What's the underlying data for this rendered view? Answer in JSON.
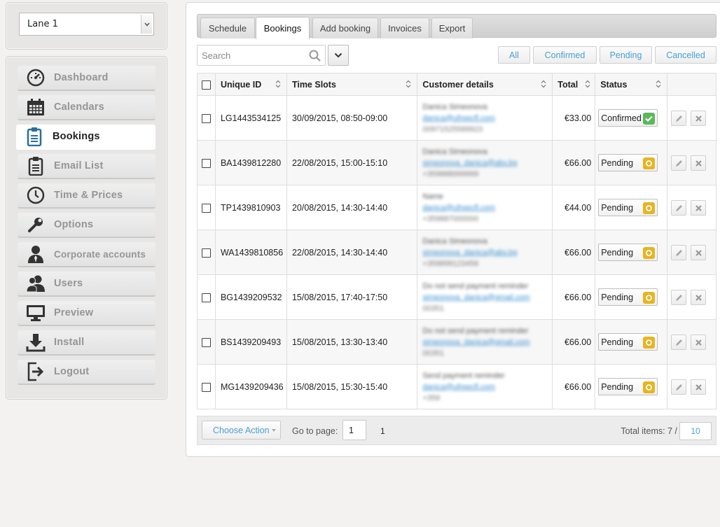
{
  "lane_select": {
    "value": "Lane 1"
  },
  "sidebar": {
    "items": [
      {
        "label": "Dashboard",
        "icon": "dashboard-icon"
      },
      {
        "label": "Calendars",
        "icon": "calendar-icon"
      },
      {
        "label": "Bookings",
        "icon": "clipboard-icon",
        "active": true
      },
      {
        "label": "Email List",
        "icon": "clipboard-icon"
      },
      {
        "label": "Time & Prices",
        "icon": "clock-icon"
      },
      {
        "label": "Options",
        "icon": "wrench-icon"
      },
      {
        "label": "Corporate accounts",
        "icon": "businessman-icon"
      },
      {
        "label": "Users",
        "icon": "users-icon"
      },
      {
        "label": "Preview",
        "icon": "monitor-icon"
      },
      {
        "label": "Install",
        "icon": "download-icon"
      },
      {
        "label": "Logout",
        "icon": "logout-icon"
      }
    ]
  },
  "tabs": [
    {
      "label": "Schedule"
    },
    {
      "label": "Bookings",
      "active": true
    },
    {
      "label": "Add booking"
    },
    {
      "label": "Invoices"
    },
    {
      "label": "Export"
    }
  ],
  "search": {
    "placeholder": "Search"
  },
  "filters": [
    {
      "label": "All"
    },
    {
      "label": "Confirmed"
    },
    {
      "label": "Pending"
    },
    {
      "label": "Cancelled"
    }
  ],
  "table": {
    "columns": [
      "Unique ID",
      "Time Slots",
      "Customer details",
      "Total",
      "Status"
    ],
    "rows": [
      {
        "id": "LG1443534125",
        "slot": "30/09/2015, 08:50-09:00",
        "cust": [
          "Danica Simeonova",
          "danica@ufreecfl.com",
          "00971525589923"
        ],
        "total": "€33.00",
        "status": "Confirmed"
      },
      {
        "id": "BA1439812280",
        "slot": "22/08/2015, 15:00-15:10",
        "cust": [
          "Danica Simeonova",
          "simeonova_danica@abv.bg",
          "+359888999999"
        ],
        "total": "€66.00",
        "status": "Pending"
      },
      {
        "id": "TP1439810903",
        "slot": "20/08/2015, 14:30-14:40",
        "cust": [
          "Name",
          "danica@ufreecfl.com",
          "+359887000000"
        ],
        "total": "€44.00",
        "status": "Pending"
      },
      {
        "id": "WA1439810856",
        "slot": "22/08/2015, 14:30-14:40",
        "cust": [
          "Danica Simeonova",
          "simeonova_danica@abv.bg",
          "+359899123456"
        ],
        "total": "€66.00",
        "status": "Pending"
      },
      {
        "id": "BG1439209532",
        "slot": "15/08/2015, 17:40-17:50",
        "cust": [
          "Do not send payment reminder",
          "simeonova_danica@gmail.com",
          "00351"
        ],
        "total": "€66.00",
        "status": "Pending"
      },
      {
        "id": "BS1439209493",
        "slot": "15/08/2015, 13:30-13:40",
        "cust": [
          "Do not send payment reminder",
          "simeonova_danica@gmail.com",
          "00351"
        ],
        "total": "€66.00",
        "status": "Pending"
      },
      {
        "id": "MG1439209436",
        "slot": "15/08/2015, 15:30-15:40",
        "cust": [
          "Send payment reminder",
          "danica@ufreecfl.com",
          "+359"
        ],
        "total": "€66.00",
        "status": "Pending"
      }
    ]
  },
  "footer": {
    "choose_action": "Choose Action",
    "goto_label": "Go to page:",
    "goto_value": "1",
    "pages": "1",
    "total_label": "Total items: 7 /",
    "per_page": "10"
  },
  "colors": {
    "link_blue": "#4a9fd4",
    "confirmed_green": "#5cb85c",
    "pending_yellow": "#e8b420"
  }
}
